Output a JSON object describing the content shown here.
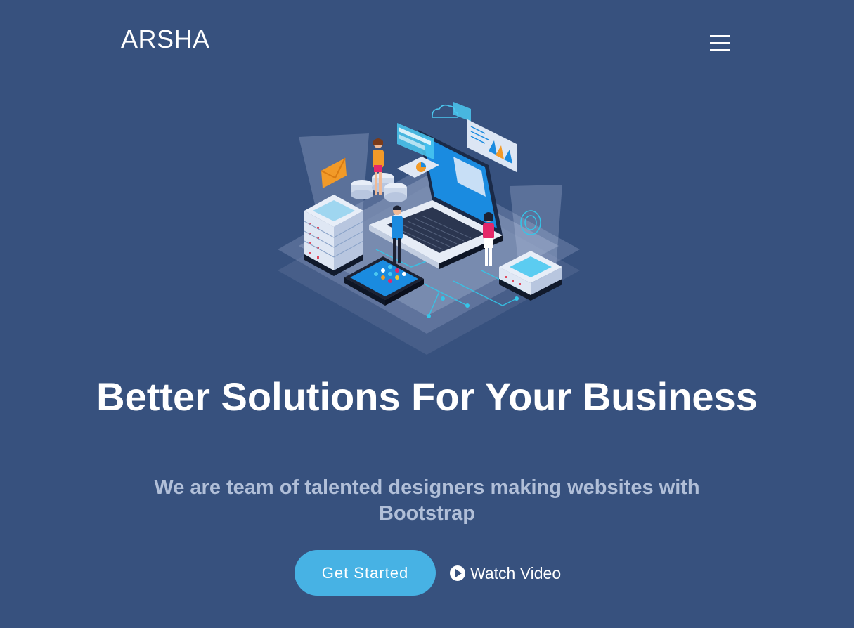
{
  "header": {
    "logo": "ARSHA",
    "menu_icon": "hamburger-menu-icon"
  },
  "hero": {
    "illustration": "isometric-tech-illustration",
    "headline": "Better Solutions For Your Business",
    "subheadline": "We are team of talented designers making websites with Bootstrap",
    "cta_primary": "Get Started",
    "cta_secondary": "Watch Video",
    "cta_secondary_icon": "play-circle-icon"
  },
  "colors": {
    "background": "#37517e",
    "accent": "#47b2e4",
    "subtext": "#b1bfd8",
    "text": "#ffffff"
  }
}
